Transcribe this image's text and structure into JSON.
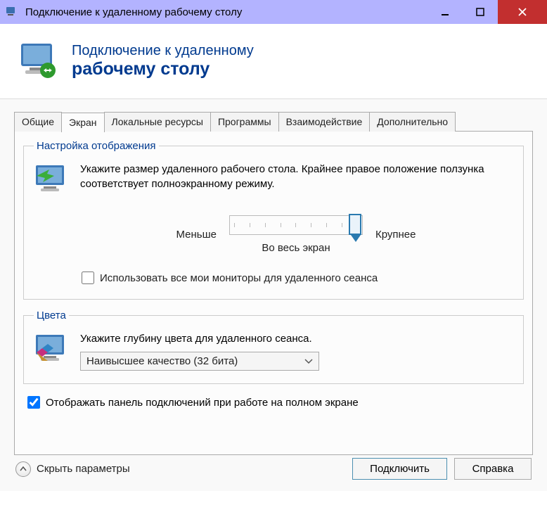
{
  "titlebar": {
    "title": "Подключение к удаленному рабочему столу"
  },
  "header": {
    "line1": "Подключение к удаленному",
    "line2": "рабочему столу"
  },
  "tabs": [
    {
      "label": "Общие",
      "active": false
    },
    {
      "label": "Экран",
      "active": true
    },
    {
      "label": "Локальные ресурсы",
      "active": false
    },
    {
      "label": "Программы",
      "active": false
    },
    {
      "label": "Взаимодействие",
      "active": false
    },
    {
      "label": "Дополнительно",
      "active": false
    }
  ],
  "display_group": {
    "legend": "Настройка отображения",
    "desc": "Укажите размер удаленного рабочего стола. Крайнее правое положение ползунка соответствует полноэкранному режиму.",
    "less": "Меньше",
    "more": "Крупнее",
    "fullscreen": "Во весь экран",
    "use_all_monitors": "Использовать все мои мониторы для удаленного сеанса",
    "use_all_monitors_checked": false
  },
  "colors_group": {
    "legend": "Цвета",
    "desc": "Укажите глубину цвета для удаленного сеанса.",
    "selected": "Наивысшее качество (32 бита)"
  },
  "connection_bar": {
    "label": "Отображать панель подключений при работе на полном экране",
    "checked": true
  },
  "footer": {
    "hide": "Скрыть параметры",
    "connect": "Подключить",
    "help": "Справка"
  }
}
